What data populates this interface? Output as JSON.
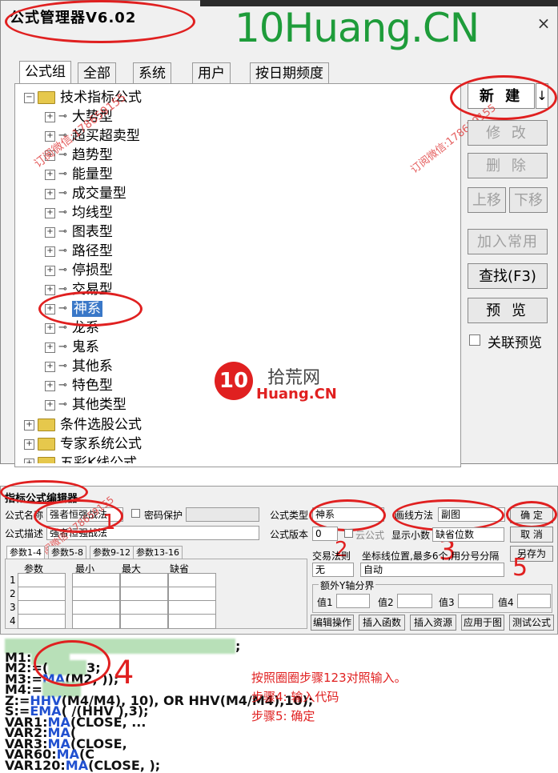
{
  "top_window": {
    "title": "公式管理器V6.02",
    "watermark": "10Huang.CN",
    "tabs": [
      "公式组",
      "全部",
      "系统",
      "用户",
      "按日期频度"
    ],
    "tree": {
      "root": "技术指标公式",
      "children": [
        "大势型",
        "超买超卖型",
        "趋势型",
        "能量型",
        "成交量型",
        "均线型",
        "图表型",
        "路径型",
        "停损型",
        "交易型",
        "神系",
        "龙系",
        "鬼系",
        "其他系",
        "特色型",
        "其他类型"
      ],
      "selected": "神系",
      "folders": [
        "条件选股公式",
        "专家系统公式",
        "五彩K线公式"
      ]
    },
    "buttons": {
      "new": "新 建",
      "modify": "修 改",
      "delete": "删 除",
      "move_up": "上移",
      "move_down": "下移",
      "add_common": "加入常用",
      "find": "查找(F3)",
      "preview": "预 览"
    },
    "linked_preview_label": "关联预览",
    "arrow_glyph": "↓",
    "side_watermark": "订阅微信:178659155",
    "left_watermark": "订阅微信:178659155"
  },
  "center_logo": {
    "mark": "10",
    "cn": "拾荒网",
    "en": "Huang.CN"
  },
  "editor": {
    "title": "指标公式编辑器",
    "name_label": "公式名称",
    "name_value": "强者恒强战法",
    "password_label": "密码保护",
    "desc_label": "公式描述",
    "desc_value": "强者恒强战法",
    "type_label": "公式类型",
    "type_value": "神系",
    "draw_label": "画线方法",
    "draw_value": "副图",
    "version_label": "公式版本",
    "version_value": "0",
    "cloud_label": "云公式",
    "decimal_label": "显示小数",
    "decimal_value": "缺省位数",
    "ok": "确 定",
    "cancel": "取 消",
    "save_as": "另存为",
    "param_tabs": [
      "参数1-4",
      "参数5-8",
      "参数9-12",
      "参数13-16"
    ],
    "param_headers": [
      "参数",
      "最小",
      "最大",
      "缺省"
    ],
    "row_numbers": [
      "1",
      "2",
      "3",
      "4"
    ],
    "trade_rule_label": "交易法则",
    "coord_label": "坐标线位置,最多6个,用分号分隔",
    "trade_rule_value": "无",
    "coord_value": "自动",
    "yaxis_group": "额外Y轴分界",
    "y_labels": [
      "值1",
      "值2",
      "值3",
      "值4"
    ],
    "tool_buttons": [
      "编辑操作",
      "插入函数",
      "插入资源",
      "应用于图",
      "测试公式"
    ],
    "side_watermark": "订阅微信:178659155"
  },
  "code": {
    "lines": [
      {
        "prefix": "",
        "fn": "",
        "tail": ";"
      },
      {
        "prefix": "M1:",
        "fn": "",
        "tail": ""
      },
      {
        "prefix": "M2:=(",
        "fn": "",
        "tail": "3;"
      },
      {
        "prefix": "M3:=",
        "fn": "MA",
        "tail": "(M2,    ));"
      },
      {
        "prefix": "M4:=",
        "fn": "",
        "tail": ""
      },
      {
        "prefix": "Z:=",
        "fn": "HHV",
        "tail": "(M4/M4), 10), OR HHV(M4/M4),10);"
      },
      {
        "prefix": "S:=",
        "fn": "EMA",
        "tail": "(      /(HHV       ),3);"
      },
      {
        "prefix": "VAR1:",
        "fn": "MA",
        "tail": "(CLOSE,    ..."
      },
      {
        "prefix": "VAR2:",
        "fn": "MA",
        "tail": "("
      },
      {
        "prefix": "VAR3:",
        "fn": "MA",
        "tail": "(CLOSE,"
      },
      {
        "prefix": "VAR60:",
        "fn": "MA",
        "tail": "(C"
      },
      {
        "prefix": "VAR120:",
        "fn": "MA",
        "tail": "(CLOSE,    );"
      }
    ],
    "annotations": [
      "按照圈圈步骤123对照输入。",
      "步骤4: 输入代码",
      "步骤5: 确定"
    ]
  },
  "step_marks": [
    "1",
    "2",
    "3",
    "4",
    "5"
  ],
  "colors": {
    "annotation": "#e02020",
    "watermark": "#1e9c3a",
    "selection": "#3a78c8"
  }
}
